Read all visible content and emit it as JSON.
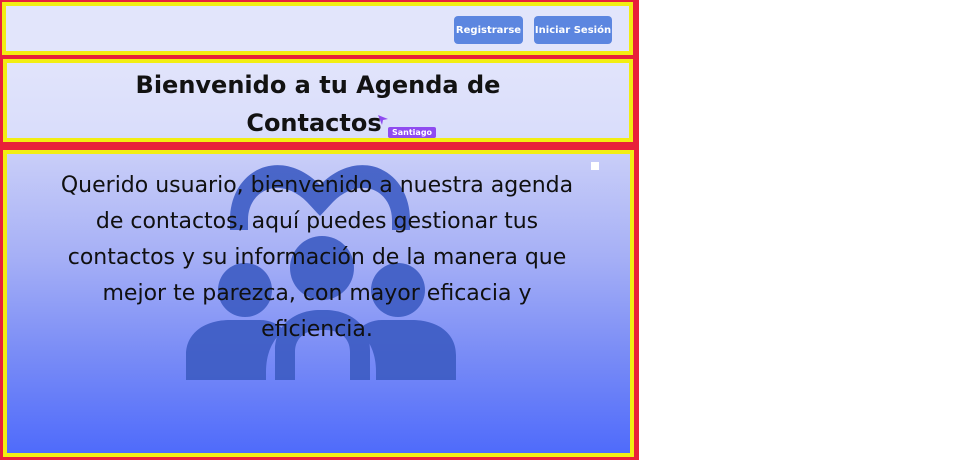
{
  "header": {
    "register_label": "Registrarse",
    "login_label": "Iniciar Sesión"
  },
  "hero": {
    "title_line1": "Bienvenido a tu Agenda de",
    "title_line2": "Contactos",
    "cursor_label": "Santiago"
  },
  "main": {
    "welcome_text": "Querido usuario, bienvenido a nuestra agenda de contactos, aquí puedes gestionar tus contactos y su información de la manera que mejor te parezca, con mayor eficacia y eficiencia.",
    "background_icon": "contacts-group-icon"
  },
  "colors": {
    "frame_border": "#e8213a",
    "inner_border": "#f2ee12",
    "button_bg": "#5c86e0",
    "cursor_accent": "#8f4bf0"
  }
}
